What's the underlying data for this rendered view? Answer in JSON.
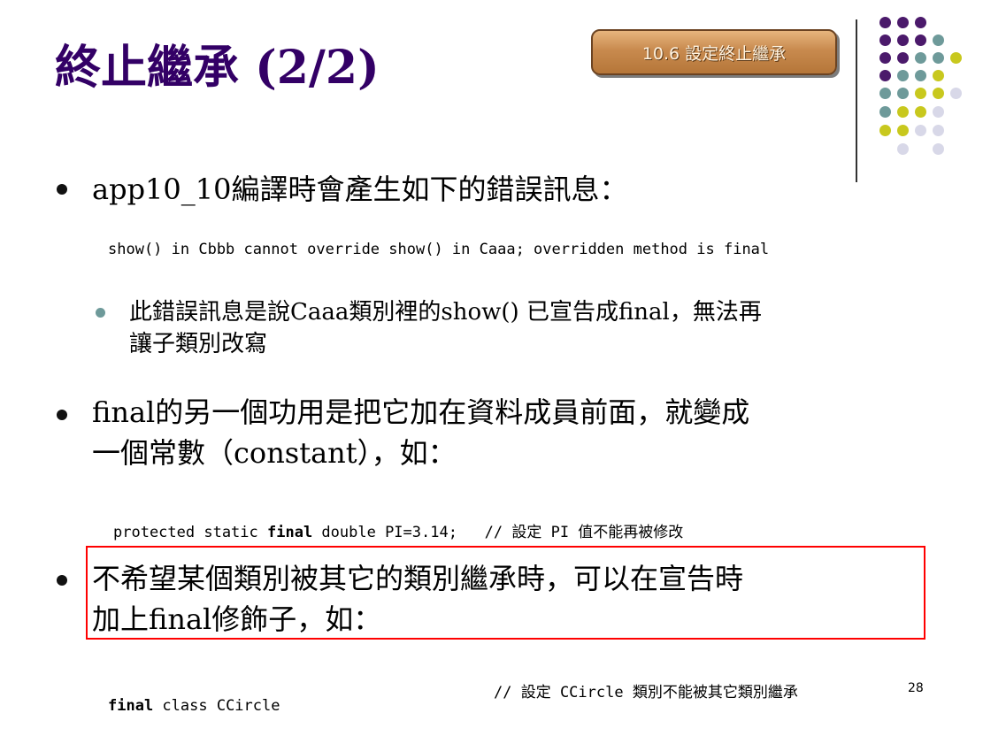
{
  "slide": {
    "title": "終止繼承 (2/2)",
    "section_badge": "10.6  設定終止繼承",
    "page_number": "28"
  },
  "bullets": [
    {
      "text": "app10_10編譯時會產生如下的錯誤訊息：",
      "code": "show() in Cbbb cannot override show() in Caaa; overridden method is final",
      "sub": {
        "line1": "此錯誤訊息是說Caaa類別裡的show() 已宣告成final，無法再",
        "line2": "讓子類別改寫"
      }
    },
    {
      "line1": "final的另一個功用是把它加在資料成員前面，就變成",
      "line2": "一個常數（constant），如：",
      "code": {
        "before": "protected static ",
        "keyword": "final",
        "after": " double PI=3.14;   ",
        "comment": "// 設定 PI 值不能再被修改"
      }
    },
    {
      "line1": "不希望某個類別被其它的類別繼承時，可以在宣告時",
      "line2": "加上final修飾子，如：",
      "code": {
        "keyword": "final",
        "after": " class CCircle",
        "comment": "// 設定 CCircle 類別不能被其它類別繼承"
      }
    }
  ],
  "colors": {
    "title": "#330066",
    "purple": "#4b1a6b",
    "teal": "#6e9a9a",
    "olive": "#c8c81e",
    "lavender": "#d8d8e8",
    "highlight_border": "#ff0000"
  }
}
